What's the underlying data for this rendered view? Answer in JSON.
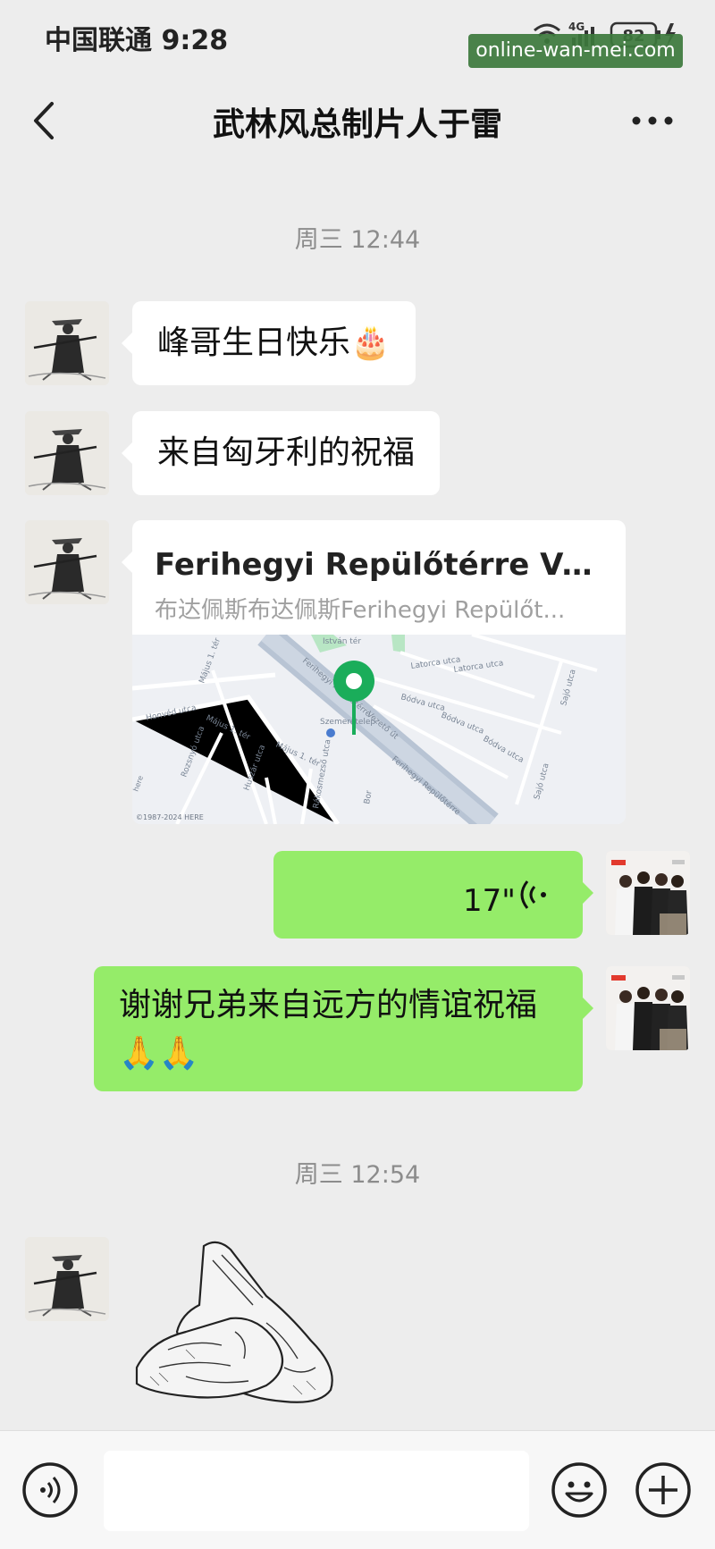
{
  "status_bar": {
    "carrier_time": "中国联通 9:28",
    "network": "4G",
    "battery": "82",
    "watermark": "online-wan-mei.com"
  },
  "header": {
    "title": "武林风总制片人于雷"
  },
  "messages": {
    "time1": "周三 12:44",
    "msg1": "峰哥生日快乐🎂",
    "msg2": "来自匈牙利的祝福",
    "location": {
      "title": "Ferihegyi Repülőtérre Vez...",
      "subtitle": "布达佩斯布达佩斯Ferihegyi Repülőt...",
      "map_labels": {
        "istvan": "István tér",
        "latorca1": "Latorca utca",
        "latorca2": "Latorca utca",
        "bodva1": "Bódva utca",
        "bodva2": "Bódva utca",
        "bodva3": "Bódva utca",
        "majus1": "Május 1. tér",
        "majus2": "Május 1. tér",
        "majus3": "Május 1. tér",
        "honved": "Honvéd utca",
        "rozsnyo": "Rozsnyó utca",
        "huszar": "Huszár utca",
        "ferihegyi1": "Ferihegyi Repülőtérre",
        "ferihegyi2": "Ferihegyi Repülőtérre",
        "vezeto": "Vezető út",
        "szemere": "Szemeretelep",
        "sajo": "Sajó utca",
        "sajo2": "Sajó utca",
        "rakos": "Rákosmezső utca",
        "borsod": "Bor",
        "here": "©1987-2024 HERE",
        "here2": "here"
      }
    },
    "voice_duration": "17\"",
    "msg_reply": "谢谢兄弟来自远方的情谊祝福🙏🙏",
    "time2": "周三 12:54"
  },
  "icons": {
    "back": "chevron-left-icon",
    "more": "more-dots-icon",
    "voice": "voice-input-icon",
    "emoji": "emoji-icon",
    "plus": "plus-icon",
    "wave": "voice-wave-icon",
    "pin": "map-pin-icon"
  },
  "colors": {
    "background": "#ededed",
    "bubble_out": "#95ec69",
    "bubble_in": "#ffffff",
    "pin": "#1aad5a"
  }
}
